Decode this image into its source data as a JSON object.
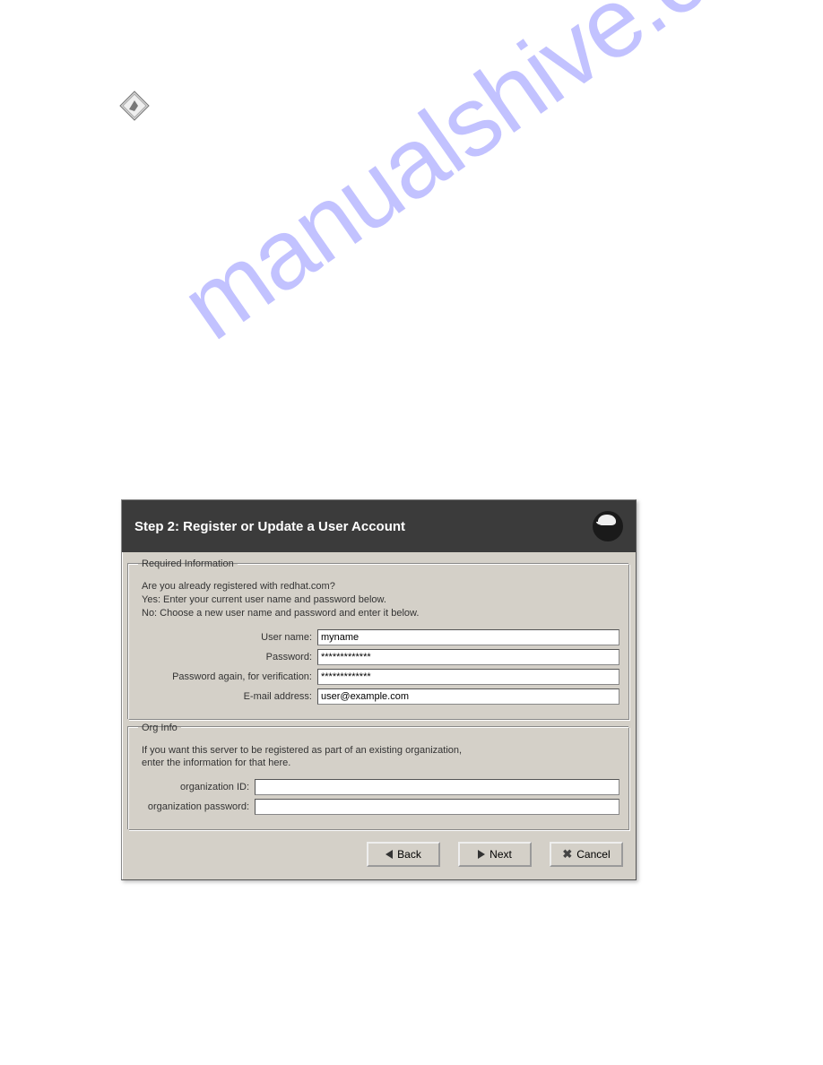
{
  "watermark": "manualshive.com",
  "dialog": {
    "title": "Step 2: Register or Update a User Account",
    "required": {
      "legend": "Required Information",
      "intro_q": "Are you already registered with redhat.com?",
      "intro_yes": "Yes: Enter your current user name and password below.",
      "intro_no": "No: Choose a new user name and password and enter it below.",
      "username_label": "User name:",
      "username_value": "myname",
      "password_label": "Password:",
      "password_value": "*************",
      "password2_label": "Password again, for verification:",
      "password2_value": "*************",
      "email_label": "E-mail address:",
      "email_value": "user@example.com"
    },
    "org": {
      "legend": "Org Info",
      "intro1": "If you want this server to be registered as part of an existing organization,",
      "intro2": "enter the information for that here.",
      "orgid_label": "organization ID:",
      "orgid_value": "",
      "orgpw_label": "organization password:",
      "orgpw_value": ""
    },
    "buttons": {
      "back": "Back",
      "next": "Next",
      "cancel": "Cancel"
    }
  }
}
